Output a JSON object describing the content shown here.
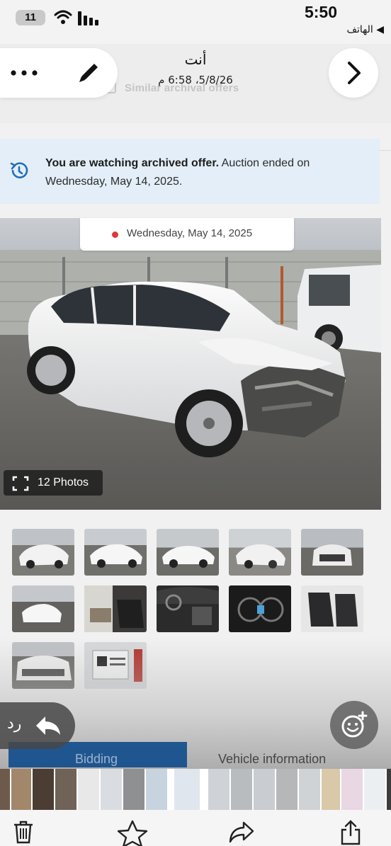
{
  "status_bar": {
    "battery": "11",
    "time": "5:50",
    "back_to_app": "◀ الهاتف",
    "icons": [
      "wifi-icon",
      "signal-icon"
    ]
  },
  "header": {
    "sender": "أنت",
    "timestamp": "5/8/26، 6:58 م",
    "behind_text": "Similar archival offers",
    "icons": [
      "more-icon",
      "edit-icon",
      "chevron-right-icon"
    ]
  },
  "notice": {
    "bold": "You are watching archived offer.",
    "rest": " Auction ended on Wednesday, May 14, 2025.",
    "icon": "history-icon",
    "color": "#e3eef8"
  },
  "photo": {
    "date": "Wednesday, May 14, 2025",
    "photos_label": "12 Photos",
    "icon": "fullscreen-icon"
  },
  "thumbnails_count": 12,
  "bottom": {
    "reply": "رد",
    "tab_bidding": "Bidding",
    "tab_vehicle": "Vehicle information",
    "accent": "#104b8c",
    "icons": [
      "reply-icon",
      "add-reaction-icon"
    ]
  },
  "toolbar": {
    "icons": [
      "trash-icon",
      "star-icon",
      "forward-icon",
      "share-icon"
    ]
  }
}
